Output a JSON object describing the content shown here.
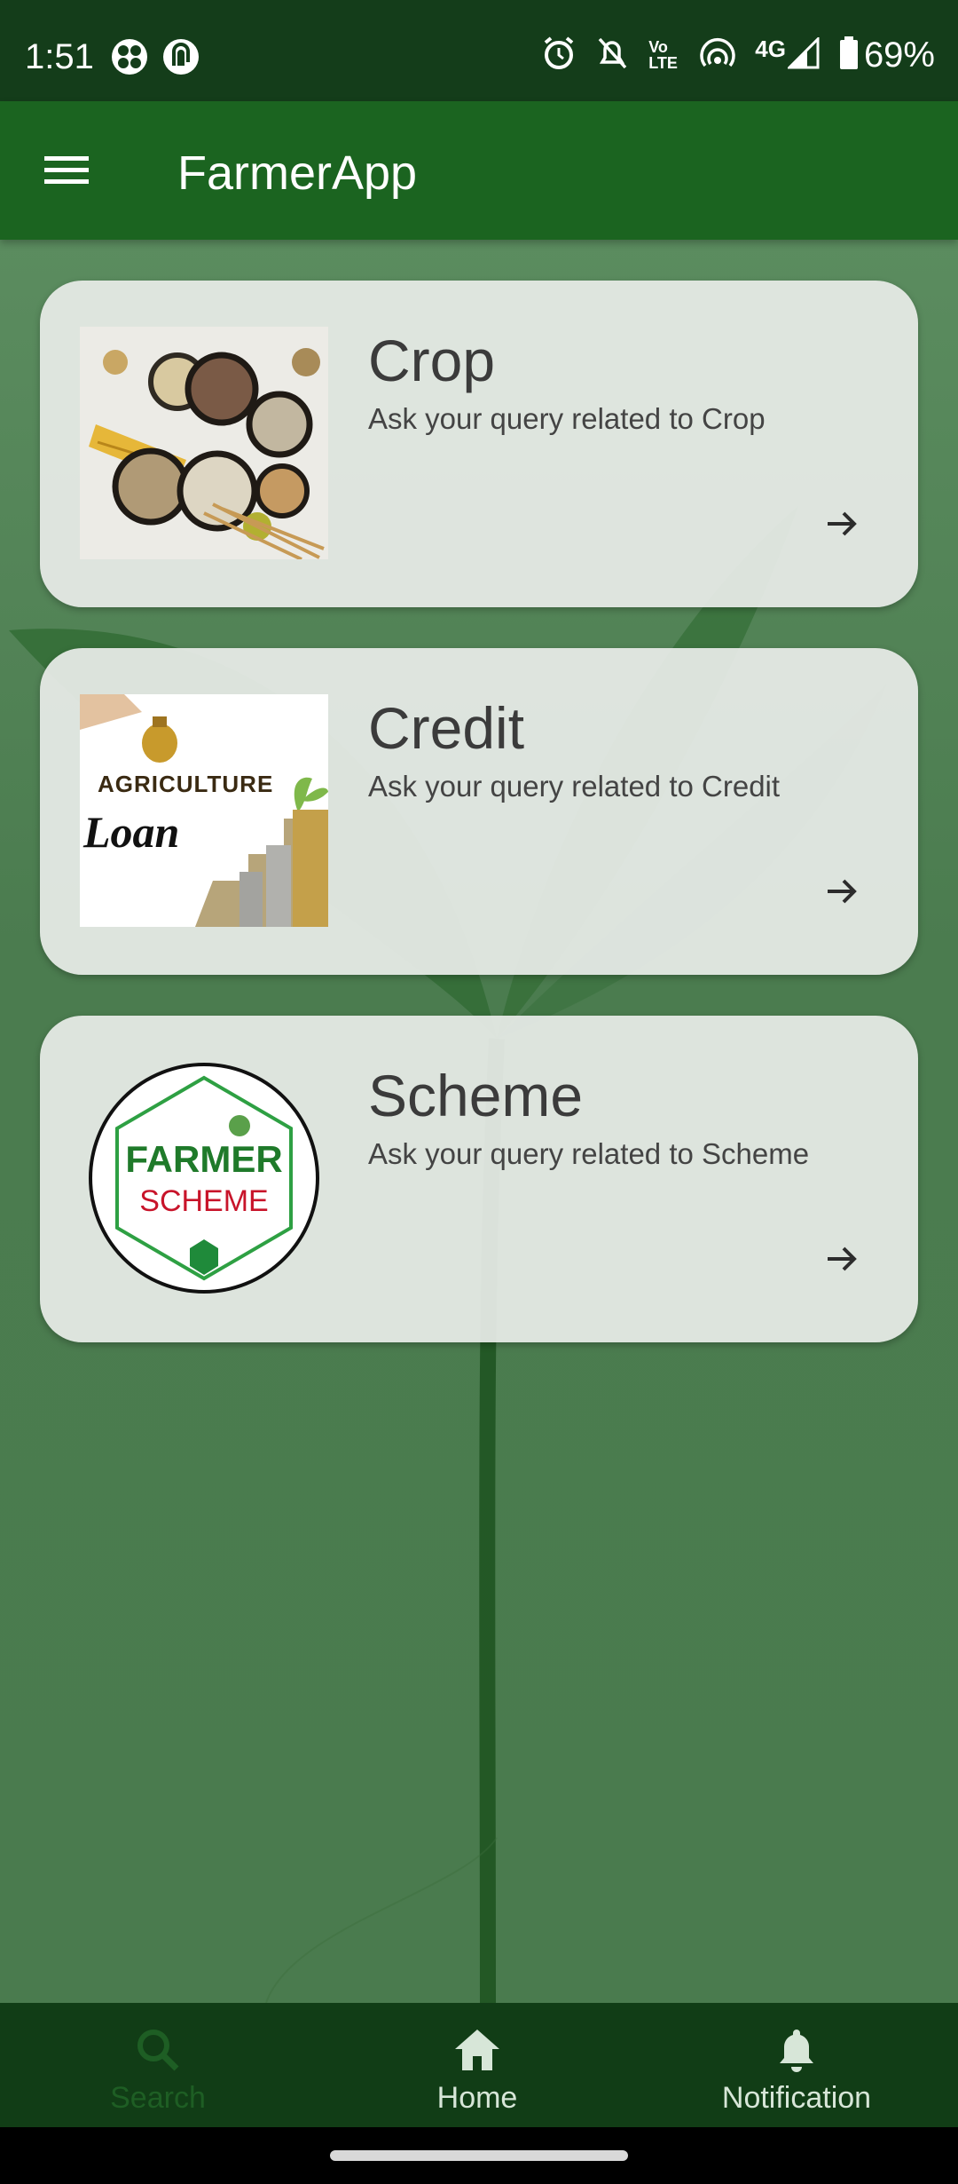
{
  "status_bar": {
    "time": "1:51",
    "network": "4G",
    "volte": "Vo LTE",
    "battery": "69%"
  },
  "app_bar": {
    "title": "FarmerApp",
    "menu_icon": "hamburger-menu-icon"
  },
  "cards": [
    {
      "title": "Crop",
      "subtitle": "Ask your query related to Crop",
      "image": "grains-bowls-image",
      "arrow_icon": "arrow-right-icon"
    },
    {
      "title": "Credit",
      "subtitle": "Ask your query related to Credit",
      "image": "agriculture-loan-image",
      "image_text_1": "AGRICULTURE",
      "image_text_2": "Loan",
      "arrow_icon": "arrow-right-icon"
    },
    {
      "title": "Scheme",
      "subtitle": "Ask your query related to Scheme",
      "image": "farmer-scheme-logo",
      "image_text_1": "FARMER",
      "image_text_2": "SCHEME",
      "arrow_icon": "arrow-right-icon"
    }
  ],
  "bottom_nav": {
    "items": [
      {
        "label": "Search",
        "icon": "search-icon",
        "active": false
      },
      {
        "label": "Home",
        "icon": "home-icon",
        "active": true
      },
      {
        "label": "Notification",
        "icon": "bell-icon",
        "active": false
      }
    ]
  },
  "colors": {
    "status_bar": "#143d1a",
    "app_bar": "#1b6420",
    "bottom_nav": "#113d16",
    "card": "#e8ece8",
    "nav_inactive": "#1e5e24",
    "nav_active": "#d7e6d8"
  }
}
